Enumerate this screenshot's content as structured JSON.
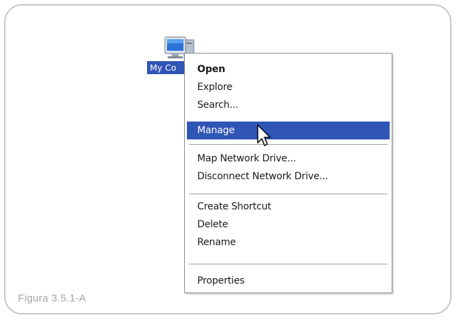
{
  "desktop": {
    "icon": "my-computer-icon",
    "label": "My Co"
  },
  "context_menu": {
    "items": [
      {
        "label": "Open",
        "bold": true
      },
      {
        "label": "Explore"
      },
      {
        "label": "Search..."
      },
      {
        "label": "Manage",
        "highlighted": true
      },
      {
        "label": "Map Network Drive..."
      },
      {
        "label": "Disconnect Network Drive..."
      },
      {
        "label": "Create Shortcut"
      },
      {
        "label": "Delete"
      },
      {
        "label": "Rename"
      },
      {
        "label": "Properties"
      }
    ],
    "highlight_color": "#2f55b5"
  },
  "cursor": {
    "icon": "arrow-pointer-icon"
  },
  "caption": "Figura 3.5.1-A"
}
